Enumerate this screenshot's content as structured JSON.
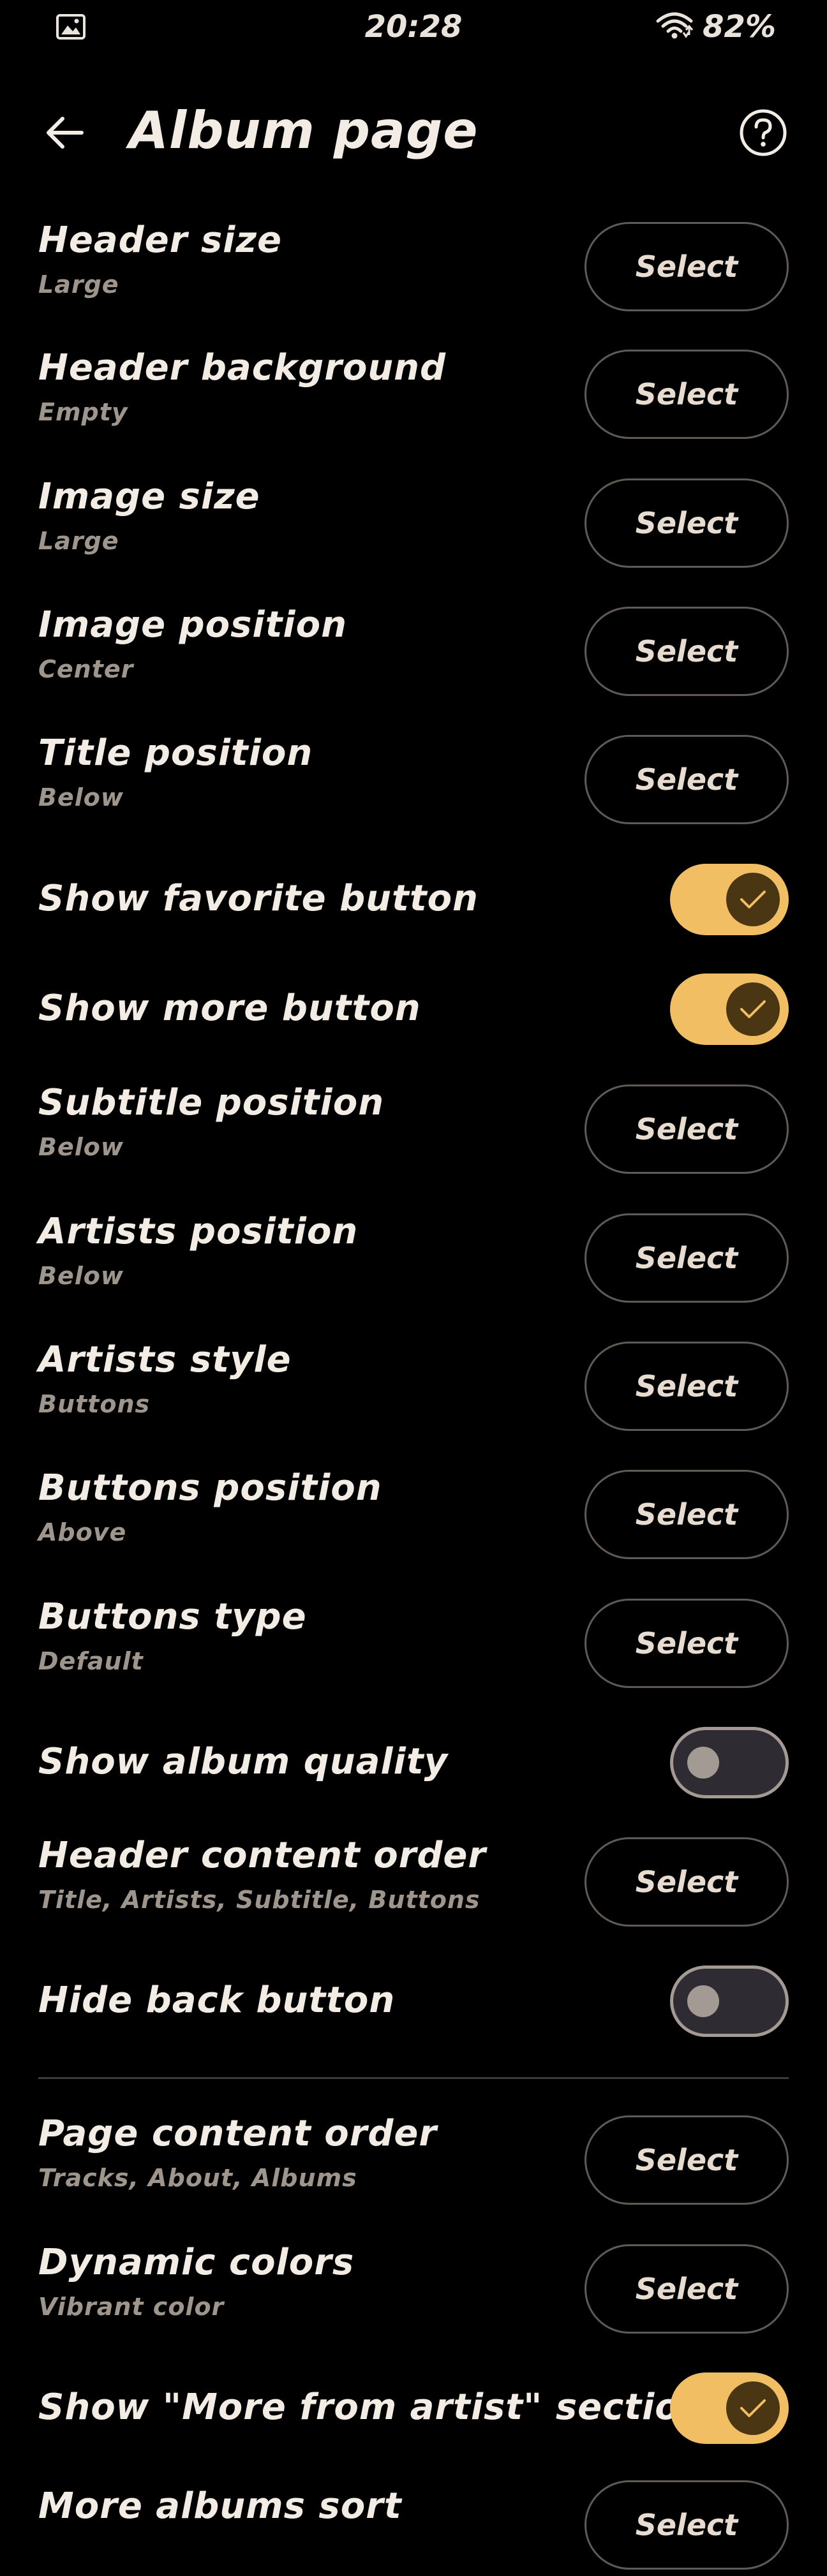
{
  "status_bar": {
    "time": "20:28",
    "battery": "82%"
  },
  "header": {
    "title": "Album page"
  },
  "settings": [
    {
      "label": "Header size",
      "value": "Large",
      "control": "select",
      "button": "Select"
    },
    {
      "label": "Header background",
      "value": "Empty",
      "control": "select",
      "button": "Select"
    },
    {
      "label": "Image size",
      "value": "Large",
      "control": "select",
      "button": "Select"
    },
    {
      "label": "Image position",
      "value": "Center",
      "control": "select",
      "button": "Select"
    },
    {
      "label": "Title position",
      "value": "Below",
      "control": "select",
      "button": "Select"
    },
    {
      "label": "Show favorite button",
      "control": "toggle",
      "checked": true
    },
    {
      "label": "Show more button",
      "control": "toggle",
      "checked": true
    },
    {
      "label": "Subtitle position",
      "value": "Below",
      "control": "select",
      "button": "Select"
    },
    {
      "label": "Artists position",
      "value": "Below",
      "control": "select",
      "button": "Select"
    },
    {
      "label": "Artists style",
      "value": "Buttons",
      "control": "select",
      "button": "Select"
    },
    {
      "label": "Buttons position",
      "value": "Above",
      "control": "select",
      "button": "Select"
    },
    {
      "label": "Buttons type",
      "value": "Default",
      "control": "select",
      "button": "Select"
    },
    {
      "label": "Show album quality",
      "control": "toggle",
      "checked": false
    },
    {
      "label": "Header content order",
      "value": "Title, Artists, Subtitle, Buttons",
      "control": "select",
      "button": "Select"
    },
    {
      "label": "Hide back button",
      "control": "toggle",
      "checked": false
    },
    {
      "label": "Page content order",
      "value": "Tracks, About, Albums",
      "control": "select",
      "button": "Select"
    },
    {
      "label": "Dynamic colors",
      "value": "Vibrant color",
      "control": "select",
      "button": "Select"
    },
    {
      "label": "Show \"More from artist\" section",
      "control": "toggle",
      "checked": true
    },
    {
      "label": "More albums sort",
      "control": "select",
      "button": "Select"
    }
  ],
  "colors": {
    "accent": "#f1be63",
    "background": "#000000",
    "text": "#f2ece4",
    "subtext": "#9e968d"
  }
}
